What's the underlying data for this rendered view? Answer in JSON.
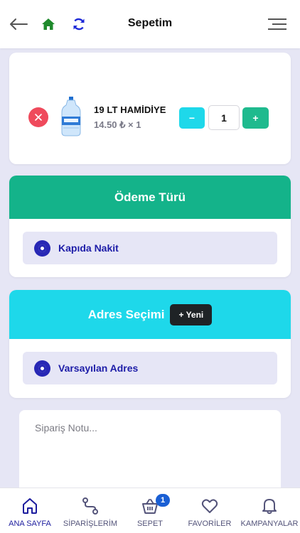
{
  "header": {
    "title": "Sepetim",
    "back_icon": "arrow-left-icon",
    "home_icon": "home-icon",
    "refresh_icon": "refresh-icon",
    "menu_icon": "menu-icon"
  },
  "cart": {
    "items": [
      {
        "name": "19 LT HAMİDİYE",
        "price_line": "14.50 ₺ × 1",
        "quantity": "1",
        "minus_label": "−",
        "plus_label": "+",
        "remove_icon": "close-icon",
        "image_icon": "water-bottle-icon"
      }
    ]
  },
  "payment": {
    "title": "Ödeme Türü",
    "selected_option": "Kapıda Nakit"
  },
  "address": {
    "title": "Adres Seçimi",
    "new_button": "+ Yeni",
    "selected_option": "Varsayılan Adres"
  },
  "note": {
    "placeholder": "Sipariş Notu..."
  },
  "bottom_nav": {
    "items": [
      {
        "label": "ANA SAYFA",
        "icon": "home-outline-icon",
        "active": true
      },
      {
        "label": "SİPARİŞLERİM",
        "icon": "route-icon",
        "active": false
      },
      {
        "label": "SEPET",
        "icon": "basket-icon",
        "active": false,
        "badge": "1"
      },
      {
        "label": "FAVORİLER",
        "icon": "heart-icon",
        "active": false
      },
      {
        "label": "KAMPANYALAR",
        "icon": "bell-icon",
        "active": false
      }
    ]
  },
  "colors": {
    "background": "#e6e6f5",
    "payment_header": "#14b38a",
    "address_header": "#1ed8ea",
    "accent_blue": "#1d1da8",
    "remove_red": "#ef4a5c",
    "minus_cyan": "#1ed8ea",
    "plus_green": "#1fba8e"
  }
}
